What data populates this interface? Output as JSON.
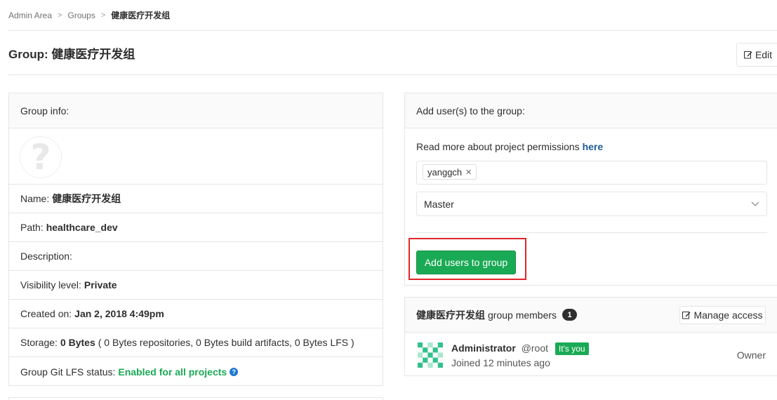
{
  "breadcrumb": {
    "items": [
      "Admin Area",
      "Groups",
      "健康医疗开发组"
    ]
  },
  "header": {
    "title_prefix": "Group:",
    "title_name": "健康医疗开发组",
    "edit_label": "Edit"
  },
  "group_info": {
    "heading": "Group info:",
    "name_label": "Name:",
    "name_value": "健康医疗开发组",
    "path_label": "Path:",
    "path_value": "healthcare_dev",
    "description_label": "Description:",
    "visibility_label": "Visibility level:",
    "visibility_value": "Private",
    "created_label": "Created on:",
    "created_value": "Jan 2, 2018 4:49pm",
    "storage_label": "Storage:",
    "storage_value": "0 Bytes",
    "storage_detail": "( 0 Bytes repositories, 0 Bytes build artifacts, 0 Bytes LFS )",
    "lfs_label": "Group Git LFS status:",
    "lfs_value": "Enabled for all projects"
  },
  "add_users": {
    "heading": "Add user(s) to the group:",
    "permissions_text": "Read more about project permissions",
    "permissions_link": "here",
    "selected_user": "yanggch",
    "role_value": "Master",
    "submit_label": "Add users to group"
  },
  "members": {
    "group_name": "健康医疗开发组",
    "heading_suffix": "group members",
    "count": "1",
    "manage_label": "Manage access",
    "list": [
      {
        "name": "Administrator",
        "handle": "@root",
        "badge": "It's you",
        "joined": "Joined 12 minutes ago",
        "role": "Owner"
      }
    ]
  },
  "colors": {
    "primary_green": "#1aaa55",
    "link_blue": "#1f5b94",
    "highlight_red": "#e0262a"
  }
}
